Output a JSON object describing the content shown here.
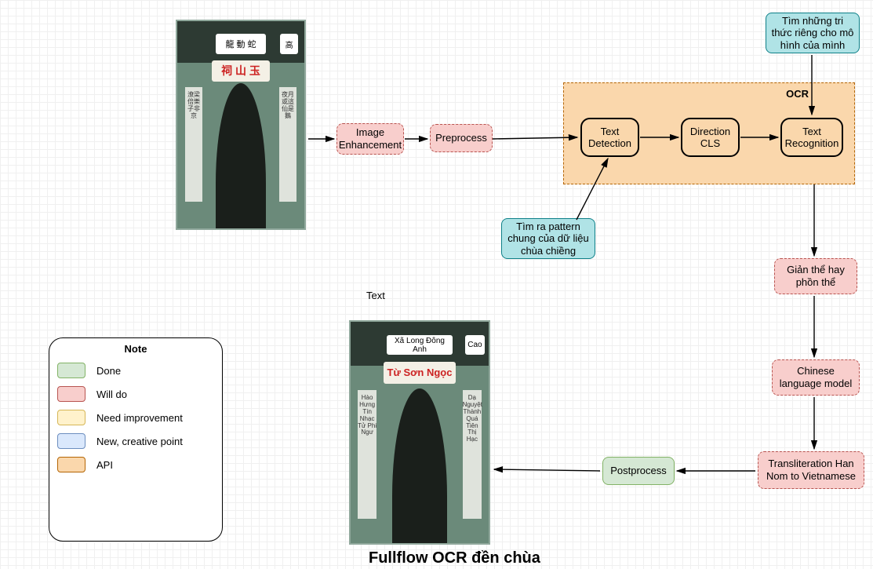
{
  "title": "Fullflow OCR đền chùa",
  "text_label": "Text",
  "ocr_container_label": "OCR",
  "nodes": {
    "image_enhancement": "Image Enhancement",
    "preprocess": "Preprocess",
    "text_detection": "Text Detection",
    "direction_cls": "Direction CLS",
    "text_recognition": "Text Recognition",
    "trithuc": "Tìm những tri thức riêng cho mô hình của mình",
    "pattern": "Tìm ra pattern chung của dữ liệu chùa chiềng",
    "gianthe": "Giản thể hay phồn thể",
    "chinese_lm": "Chinese language model",
    "translit": "Transliteration Han Nom to Vietnamese",
    "postprocess": "Postprocess"
  },
  "note": {
    "title": "Note",
    "items": [
      "Done",
      "Will do",
      "Need improvement",
      "New, creative point",
      "API"
    ]
  },
  "input_gate": {
    "top_banner": "龍 動 蛇",
    "right_top": "高",
    "main_sign": "祠 山 玉",
    "left_pillar": "潦梁倍樂子非京",
    "right_pillar": "夜月或這仙是鵝"
  },
  "output_gate": {
    "top_banner": "Xã Long Đông Anh",
    "right_top": "Cao",
    "main_sign": "Từ Sơn Ngọc",
    "left_pillar": "Hào Hưng Tín Nhạc Tử Phi Ngư",
    "right_pillar": "Dạ Nguyệt Thành Quá Tiên Thị Hạc"
  }
}
